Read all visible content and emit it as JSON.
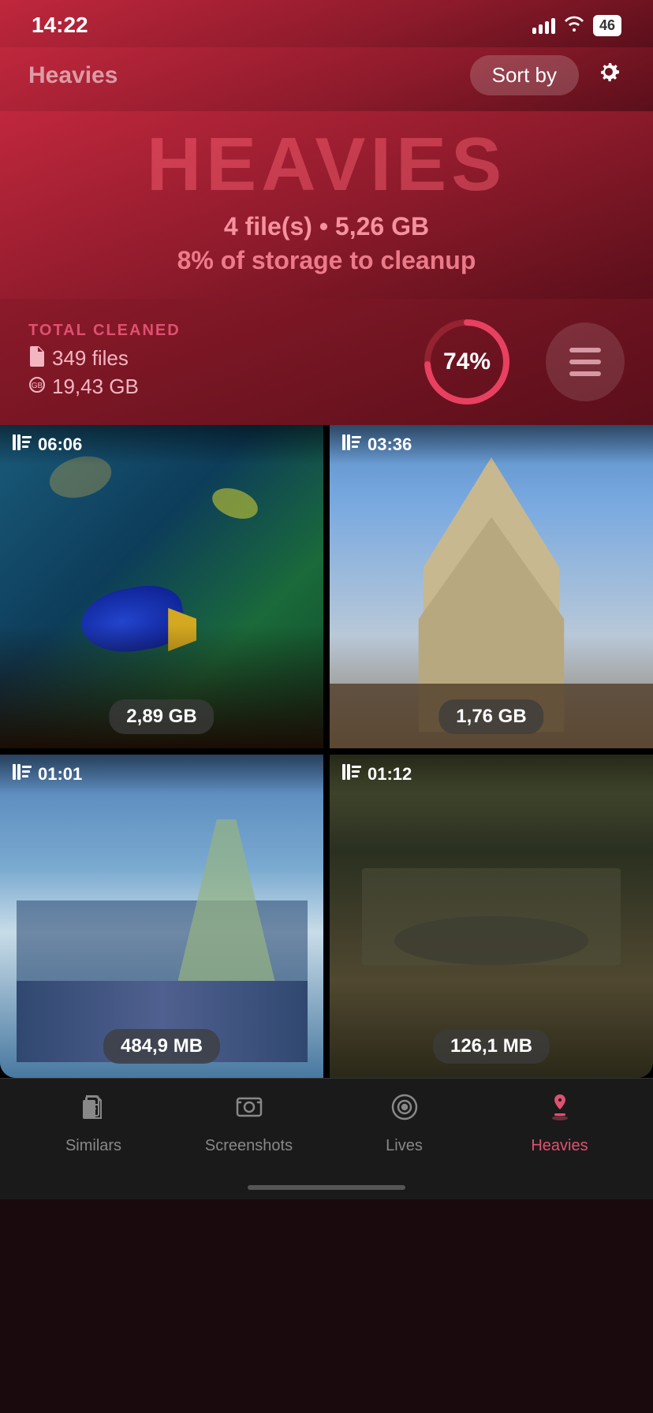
{
  "statusBar": {
    "time": "14:22",
    "battery": "46"
  },
  "header": {
    "title": "Heavies",
    "sortButton": "Sort by",
    "gearIcon": "⚙"
  },
  "hero": {
    "title": "HEAVIES",
    "subtitle": "4 file(s) • 5,26 GB",
    "cleanup": "8% of storage to cleanup"
  },
  "stats": {
    "totalCleanedLabel": "TOTAL CLEANED",
    "filesCount": "349 files",
    "gbCount": "19,43 GB",
    "progress": 74,
    "progressText": "74%"
  },
  "videos": [
    {
      "duration": "06:06",
      "size": "2,89 GB",
      "theme": "underwater"
    },
    {
      "duration": "03:36",
      "size": "1,76 GB",
      "theme": "cathedral"
    },
    {
      "duration": "01:01",
      "size": "484,9 MB",
      "theme": "harbor"
    },
    {
      "duration": "01:12",
      "size": "126,1 MB",
      "theme": "dark"
    }
  ],
  "tabs": [
    {
      "label": "Similars",
      "icon": "similars",
      "active": false
    },
    {
      "label": "Screenshots",
      "icon": "screenshots",
      "active": false
    },
    {
      "label": "Lives",
      "icon": "lives",
      "active": false
    },
    {
      "label": "Heavies",
      "icon": "heavies",
      "active": true
    }
  ]
}
